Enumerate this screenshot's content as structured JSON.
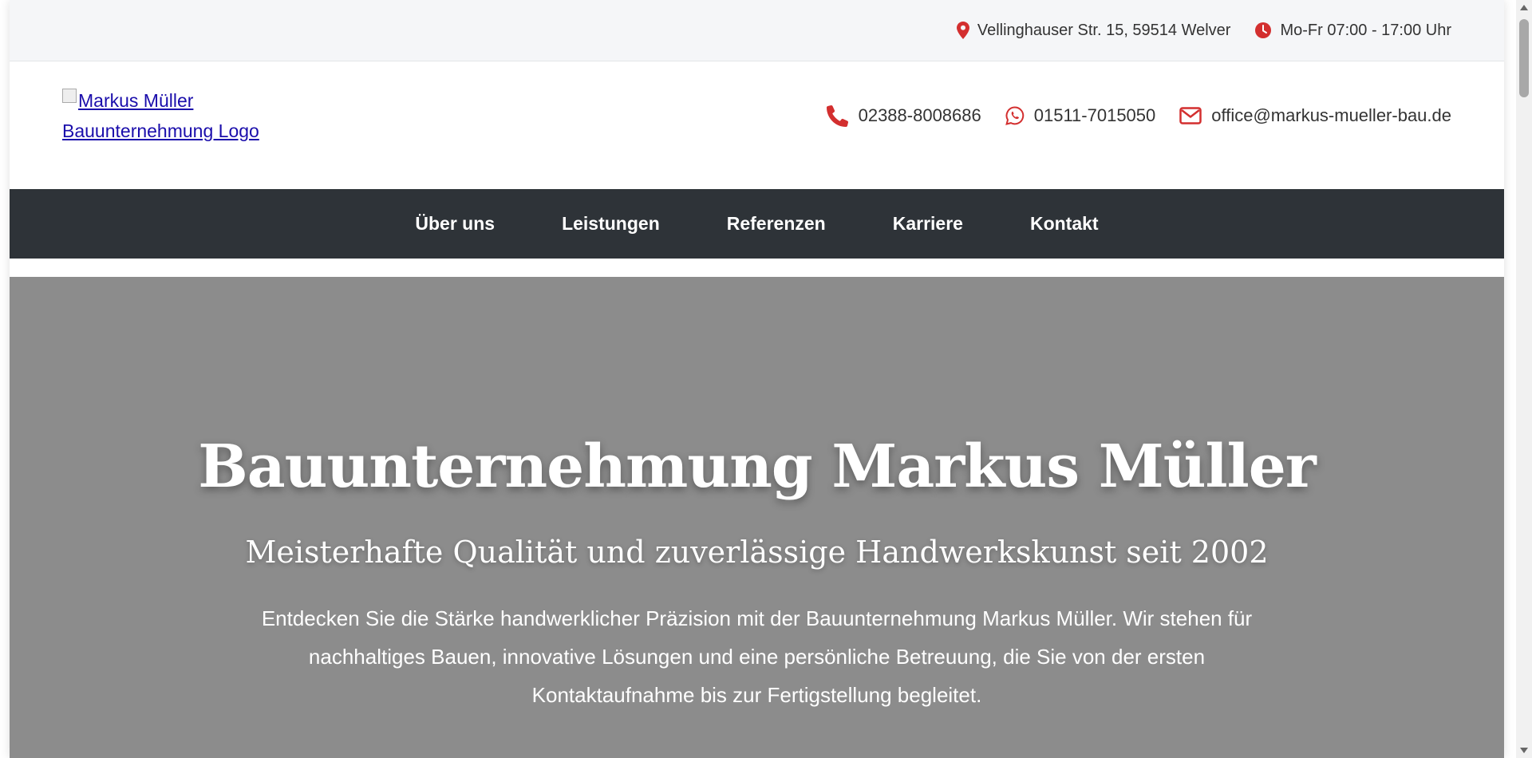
{
  "topbar": {
    "address": "Vellinghauser Str. 15, 59514 Welver",
    "hours": "Mo-Fr 07:00 - 17:00 Uhr"
  },
  "header": {
    "logo_alt": "Markus Müller Bauunternehmung Logo",
    "phone": "02388-8008686",
    "whatsapp": "01511-7015050",
    "email": "office@markus-mueller-bau.de"
  },
  "nav": {
    "items": [
      "Über uns",
      "Leistungen",
      "Referenzen",
      "Karriere",
      "Kontakt"
    ]
  },
  "hero": {
    "title": "Bauunternehmung Markus Müller",
    "subtitle": "Meisterhafte Qualität und zuverlässige Handwerkskunst seit 2002",
    "text": "Entdecken Sie die Stärke handwerklicher Präzision mit der Bauunternehmung Markus Müller. Wir stehen für nachhaltiges Bauen, innovative Lösungen und eine persönliche Betreuung, die Sie von der ersten Kontaktaufnahme bis zur Fertigstellung begleitet."
  },
  "colors": {
    "accent": "#d32f2f",
    "nav_bg": "#2e3338",
    "hero_bg": "#8c8c8c",
    "topbar_bg": "#f5f6f8"
  },
  "icons": {
    "address": "map-pin-icon",
    "hours": "clock-icon",
    "phone": "phone-icon",
    "whatsapp": "whatsapp-icon",
    "email": "envelope-icon"
  }
}
